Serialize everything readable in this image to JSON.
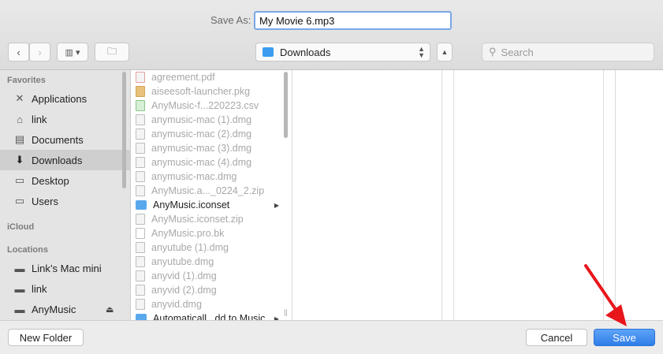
{
  "header": {
    "save_as_label": "Save As:",
    "filename": "My Movie 6.mp3"
  },
  "toolbar": {
    "location": "Downloads",
    "search_placeholder": "Search"
  },
  "sidebar": {
    "favorites_label": "Favorites",
    "favorites": [
      {
        "label": "Applications",
        "icon": "applications-icon"
      },
      {
        "label": "link",
        "icon": "home-icon"
      },
      {
        "label": "Documents",
        "icon": "documents-icon"
      },
      {
        "label": "Downloads",
        "icon": "downloads-icon",
        "selected": true
      },
      {
        "label": "Desktop",
        "icon": "desktop-icon"
      },
      {
        "label": "Users",
        "icon": "folder-icon"
      }
    ],
    "icloud_label": "iCloud",
    "locations_label": "Locations",
    "locations": [
      {
        "label": "Link’s Mac mini",
        "icon": "computer-icon"
      },
      {
        "label": "link",
        "icon": "drive-icon"
      },
      {
        "label": "AnyMusic",
        "icon": "drive-icon"
      }
    ]
  },
  "files": [
    {
      "name": "agreement.pdf",
      "type": "file"
    },
    {
      "name": "aiseesoft-launcher.pkg",
      "type": "file"
    },
    {
      "name": "AnyMusic-f...220223.csv",
      "type": "file"
    },
    {
      "name": "anymusic-mac (1).dmg",
      "type": "file"
    },
    {
      "name": "anymusic-mac (2).dmg",
      "type": "file"
    },
    {
      "name": "anymusic-mac (3).dmg",
      "type": "file"
    },
    {
      "name": "anymusic-mac (4).dmg",
      "type": "file"
    },
    {
      "name": "anymusic-mac.dmg",
      "type": "file"
    },
    {
      "name": "AnyMusic.a..._0224_2.zip",
      "type": "file"
    },
    {
      "name": "AnyMusic.iconset",
      "type": "folder"
    },
    {
      "name": "AnyMusic.iconset.zip",
      "type": "file"
    },
    {
      "name": "AnyMusic.pro.bk",
      "type": "file"
    },
    {
      "name": "anyutube (1).dmg",
      "type": "file"
    },
    {
      "name": "anyutube.dmg",
      "type": "file"
    },
    {
      "name": "anyvid (1).dmg",
      "type": "file"
    },
    {
      "name": "anyvid (2).dmg",
      "type": "file"
    },
    {
      "name": "anyvid.dmg",
      "type": "file"
    },
    {
      "name": "Automaticall...dd to Music",
      "type": "folder"
    }
  ],
  "footer": {
    "new_folder_label": "New Folder",
    "cancel_label": "Cancel",
    "save_label": "Save"
  },
  "colors": {
    "accent": "#2f7de8",
    "annotation_arrow": "#e8161b"
  }
}
